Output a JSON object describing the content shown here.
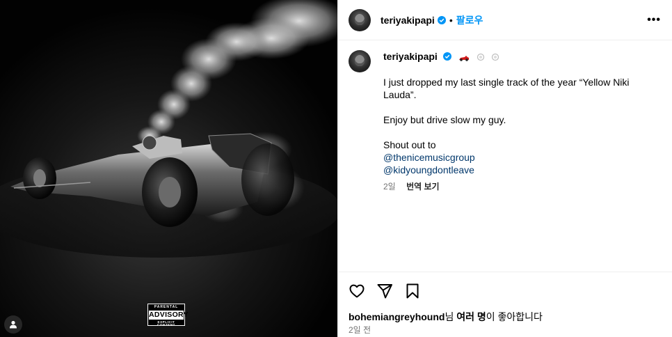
{
  "post": {
    "username": "teriyakipapi",
    "follow_label": "팔로우",
    "separator": "•",
    "more_label": "•••"
  },
  "caption": {
    "username": "teriyakipapi",
    "emoji_names": [
      "race-car-icon",
      "dash-icon",
      "dash-icon"
    ],
    "line1": "I just dropped my last single track of the year “Yellow Niki Lauda”.",
    "line2": "Enjoy but drive slow my guy.",
    "line3": "Shout out to",
    "mention1": "@thenicemusicgroup",
    "mention2": "@kidyoungdontleave",
    "age": "2일",
    "translate_label": "번역 보기"
  },
  "media": {
    "advisory_top": "PARENTAL",
    "advisory_main": "ADVISORY",
    "advisory_bottom": "EXPLICIT CONTENT"
  },
  "likes": {
    "first_user": "bohemiangreyhound",
    "suffix1": "님 ",
    "others": "여러 명",
    "suffix2": "이 좋아합니다"
  },
  "post_time": "2일 전",
  "colors": {
    "accent": "#0095f6",
    "mention": "#00376b",
    "muted": "#737373",
    "verified": "#0095f6"
  }
}
